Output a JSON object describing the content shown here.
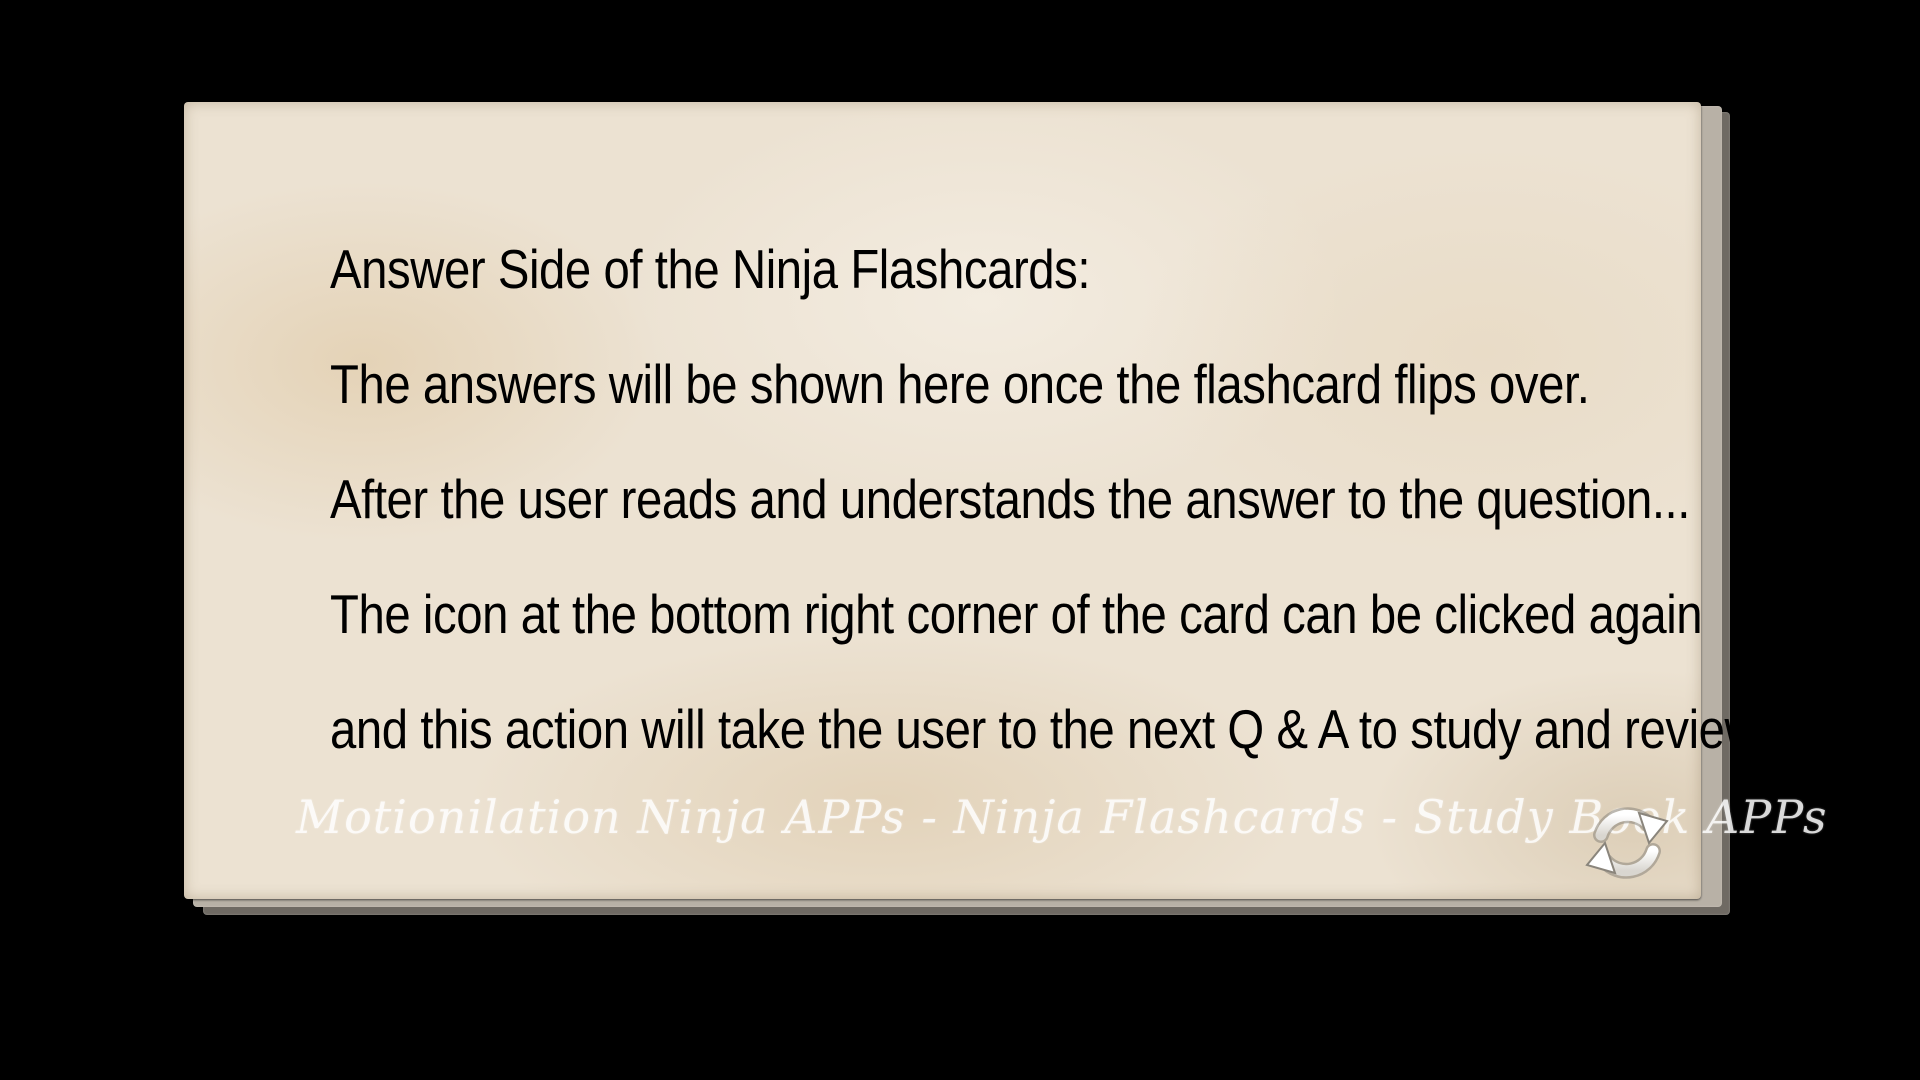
{
  "card": {
    "lines": [
      "Answer Side of the Ninja Flashcards:",
      "The answers will be shown here once the flashcard flips over.",
      "After the user reads and understands the answer to the question...",
      "The icon at the bottom right corner of the card can be clicked again",
      "and this action will take the user to the next Q & A to study and review!"
    ],
    "footer_brand": "Motionilation Ninja APPs - Ninja Flashcards - Study Book APPs"
  },
  "icons": {
    "flip": "refresh-icon"
  },
  "colors": {
    "background": "#000000",
    "card": "#ece2d2",
    "text": "#000000",
    "brand_text": "#ffffff"
  }
}
